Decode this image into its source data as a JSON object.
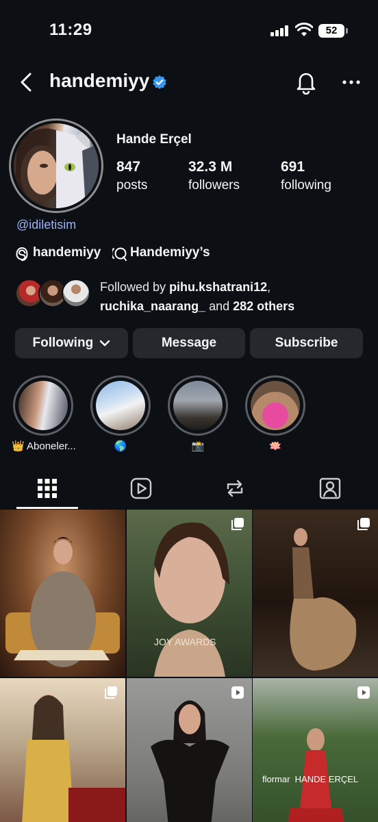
{
  "status_bar": {
    "time": "11:29",
    "battery": "52"
  },
  "header": {
    "username": "handemiyy"
  },
  "profile": {
    "full_name": "Hande Erçel",
    "stats": [
      {
        "value": "847",
        "label": "posts"
      },
      {
        "value": "32.3 M",
        "label": "followers"
      },
      {
        "value": "691",
        "label": "following"
      }
    ],
    "bio_handle": "@idiletisim",
    "threads_handle": "handemiyy",
    "channel_name": "Handemiyy’s",
    "followed_by": {
      "prefix": "Followed by ",
      "user1": "pihu.kshatrani12",
      "separator": ",",
      "user2": "ruchika_naarang_",
      "middle": " and ",
      "others": "282 others"
    }
  },
  "actions": {
    "following": "Following",
    "message": "Message",
    "subscribe": "Subscribe"
  },
  "highlights": [
    {
      "label": "👑 Aboneler..."
    },
    {
      "label": "🌎"
    },
    {
      "label": "📸"
    },
    {
      "label": "🪷"
    }
  ],
  "tabs": [
    "grid-icon",
    "reels-icon",
    "reposts-icon",
    "tagged-icon"
  ],
  "grid_posts": [
    {
      "badge": "none"
    },
    {
      "badge": "carousel",
      "overlay": "JOY AWARDS"
    },
    {
      "badge": "carousel"
    },
    {
      "badge": "carousel"
    },
    {
      "badge": "reel"
    },
    {
      "badge": "reel",
      "overlay": "flormar  HANDE ERÇEL"
    }
  ],
  "colors": {
    "background": "#0c1014",
    "button": "#25292e",
    "link": "#a0b4f2",
    "verified": "#3797f0"
  }
}
